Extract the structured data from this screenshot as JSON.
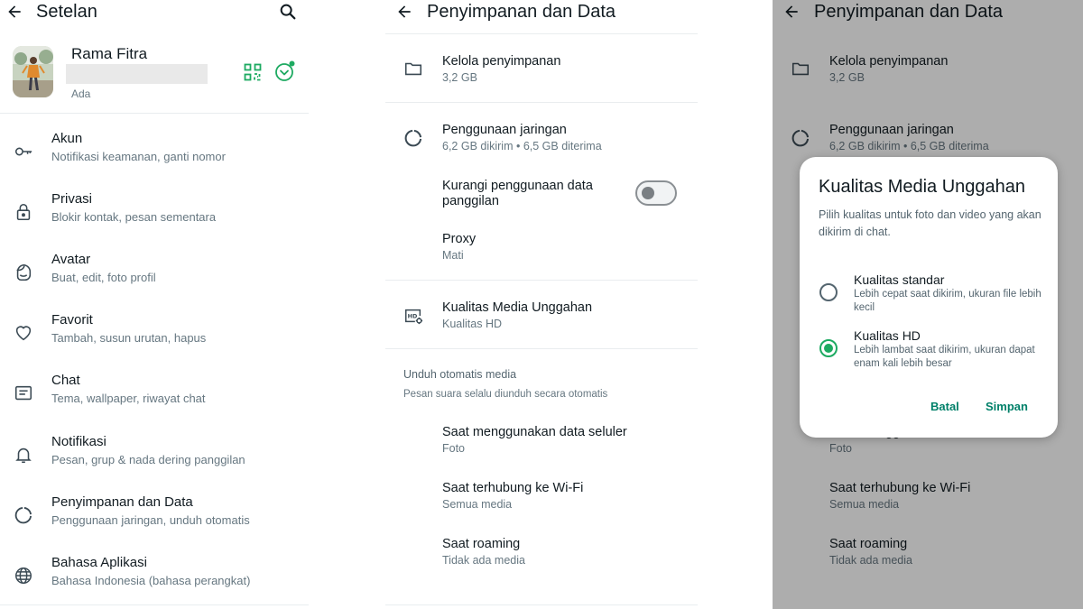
{
  "settings": {
    "title": "Setelan",
    "profile": {
      "name": "Rama Fitra",
      "status": "Ada"
    },
    "items": [
      {
        "icon": "key-icon",
        "title": "Akun",
        "subtitle": "Notifikasi keamanan, ganti nomor"
      },
      {
        "icon": "lock-icon",
        "title": "Privasi",
        "subtitle": "Blokir kontak, pesan sementara"
      },
      {
        "icon": "avatar-face-icon",
        "title": "Avatar",
        "subtitle": "Buat, edit, foto profil"
      },
      {
        "icon": "heart-icon",
        "title": "Favorit",
        "subtitle": "Tambah, susun urutan, hapus"
      },
      {
        "icon": "chat-icon",
        "title": "Chat",
        "subtitle": "Tema, wallpaper, riwayat chat"
      },
      {
        "icon": "bell-icon",
        "title": "Notifikasi",
        "subtitle": "Pesan, grup & nada dering panggilan"
      },
      {
        "icon": "data-usage-icon",
        "title": "Penyimpanan dan Data",
        "subtitle": "Penggunaan jaringan, unduh otomatis"
      },
      {
        "icon": "globe-icon",
        "title": "Bahasa Aplikasi",
        "subtitle": "Bahasa Indonesia (bahasa perangkat)"
      }
    ]
  },
  "storage": {
    "title": "Penyimpanan dan Data",
    "manage": {
      "title": "Kelola penyimpanan",
      "subtitle": "3,2 GB"
    },
    "network": {
      "title": "Penggunaan jaringan",
      "subtitle": "6,2 GB dikirim • 6,5 GB diterima"
    },
    "reduce_data": {
      "title": "Kurangi penggunaan data panggilan",
      "enabled": false
    },
    "proxy": {
      "title": "Proxy",
      "subtitle": "Mati"
    },
    "media_quality": {
      "title": "Kualitas Media Unggahan",
      "subtitle": "Kualitas HD"
    },
    "auto_download": {
      "heading": "Unduh otomatis media",
      "note": "Pesan suara selalu diunduh secara otomatis",
      "items": [
        {
          "title": "Saat menggunakan data seluler",
          "subtitle": "Foto"
        },
        {
          "title": "Saat terhubung ke Wi-Fi",
          "subtitle": "Semua media"
        },
        {
          "title": "Saat roaming",
          "subtitle": "Tidak ada media"
        }
      ]
    }
  },
  "dialog": {
    "title": "Kualitas Media Unggahan",
    "description": "Pilih kualitas untuk foto dan video yang akan dikirim di chat.",
    "options": [
      {
        "title": "Kualitas standar",
        "subtitle": "Lebih cepat saat dikirim, ukuran file lebih kecil",
        "selected": false
      },
      {
        "title": "Kualitas HD",
        "subtitle": "Lebih lambat saat dikirim, ukuran dapat enam kali lebih besar",
        "selected": true
      }
    ],
    "cancel_label": "Batal",
    "save_label": "Simpan"
  },
  "colors": {
    "accent": "#1daa61",
    "button_text": "#008069",
    "secondary_text": "#667781"
  }
}
